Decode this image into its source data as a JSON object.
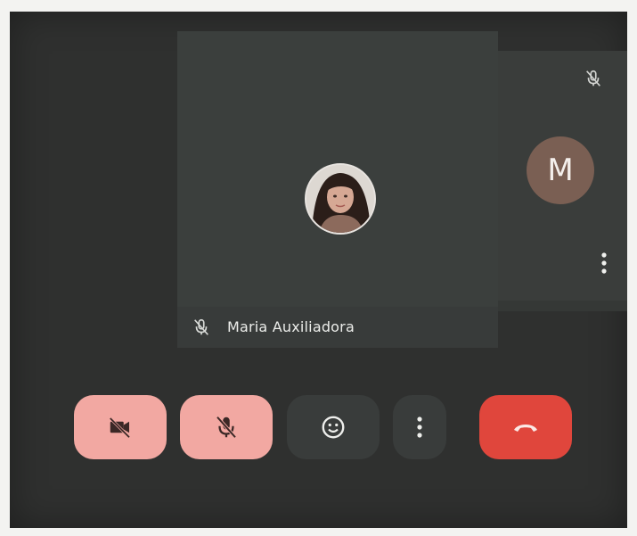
{
  "participants": {
    "main": {
      "name": "Maria Auxiliadora",
      "muted": true
    },
    "side": {
      "initial": "M",
      "muted": true,
      "avatar_color": "#7a5f53"
    }
  },
  "controls": {
    "camera": {
      "icon": "camera-off-icon",
      "state": "off",
      "color": "#f2a8a2"
    },
    "microphone": {
      "icon": "mic-off-icon",
      "state": "off",
      "color": "#f2a8a2"
    },
    "reactions": {
      "icon": "emoji-icon"
    },
    "more": {
      "icon": "more-vert-icon"
    },
    "end_call": {
      "icon": "hangup-icon",
      "color": "#e0463c"
    }
  },
  "colors": {
    "background": "#2f302f",
    "tile": "#3b3f3d",
    "text": "#ecedea"
  }
}
